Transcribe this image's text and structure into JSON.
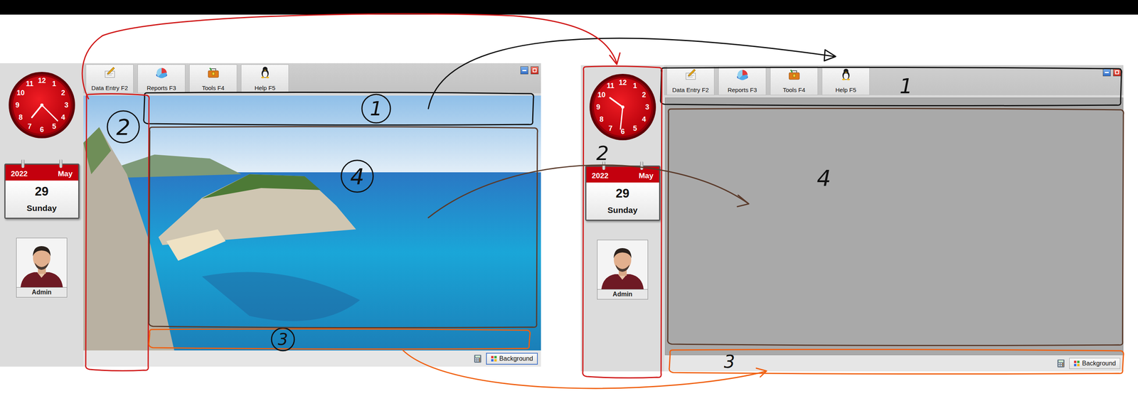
{
  "screens": [
    {
      "clock": {
        "numbers": [
          "12",
          "1",
          "2",
          "3",
          "4",
          "5",
          "6",
          "7",
          "8",
          "9",
          "10",
          "11"
        ],
        "hour_hand": 7.3,
        "minute_hand": 4.5
      },
      "calendar": {
        "year": "2022",
        "month": "May",
        "day": "29",
        "weekday": "Sunday"
      },
      "user": {
        "name": "Admin"
      },
      "toolbar": [
        {
          "label": "Data Entry F2"
        },
        {
          "label": "Reports F3"
        },
        {
          "label": "Tools F4"
        },
        {
          "label": "Help F5"
        }
      ],
      "content": {
        "kind": "photo"
      },
      "status_bar": {
        "button": "Background",
        "focused": true
      }
    },
    {
      "clock": {
        "numbers": [
          "12",
          "1",
          "2",
          "3",
          "4",
          "5",
          "6",
          "7",
          "8",
          "9",
          "10",
          "11"
        ],
        "hour_hand": 10.2,
        "minute_hand": 6.2
      },
      "calendar": {
        "year": "2022",
        "month": "May",
        "day": "29",
        "weekday": "Sunday"
      },
      "user": {
        "name": "Admin"
      },
      "toolbar": [
        {
          "label": "Data Entry F2"
        },
        {
          "label": "Reports F3"
        },
        {
          "label": "Tools F4"
        },
        {
          "label": "Help F5"
        }
      ],
      "content": {
        "kind": "empty"
      },
      "status_bar": {
        "button": "Background",
        "focused": false
      }
    }
  ],
  "annotations": [
    {
      "label": "1",
      "color": "#111111",
      "left_circled": true,
      "right_circled": false
    },
    {
      "label": "2",
      "color": "#d01818",
      "left_circled": true,
      "right_circled": false
    },
    {
      "label": "3",
      "color": "#f06010",
      "left_circled": true,
      "right_circled": false
    },
    {
      "label": "4",
      "color": "#5a3a2a",
      "left_circled": true,
      "right_circled": false
    }
  ]
}
